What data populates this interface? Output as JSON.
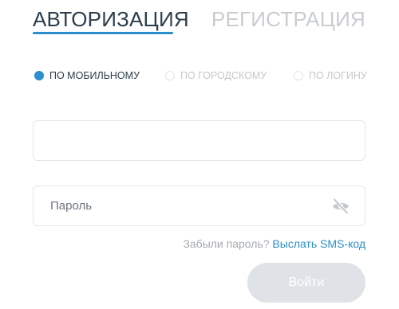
{
  "tabs": {
    "login": "АВТОРИЗАЦИЯ",
    "register": "РЕГИСТРАЦИЯ"
  },
  "login_mode": {
    "selected": "mobile",
    "options": {
      "mobile": "ПО МОБИЛЬНОМУ",
      "landline": "ПО ГОРОДСКОМУ",
      "login": "ПО ЛОГИНУ"
    }
  },
  "form": {
    "phone_value": "",
    "password_placeholder": "Пароль",
    "password_toggle_icon": "eye-off-icon"
  },
  "forgot": {
    "question": "Забыли пароль?",
    "link": "Выслать SMS-код"
  },
  "submit_label": "Войти",
  "colors": {
    "accent": "#2a8fcc",
    "text_dark": "#2c3e4c",
    "text_muted": "#c9cdd1",
    "button_disabled": "#dfe3e7"
  }
}
